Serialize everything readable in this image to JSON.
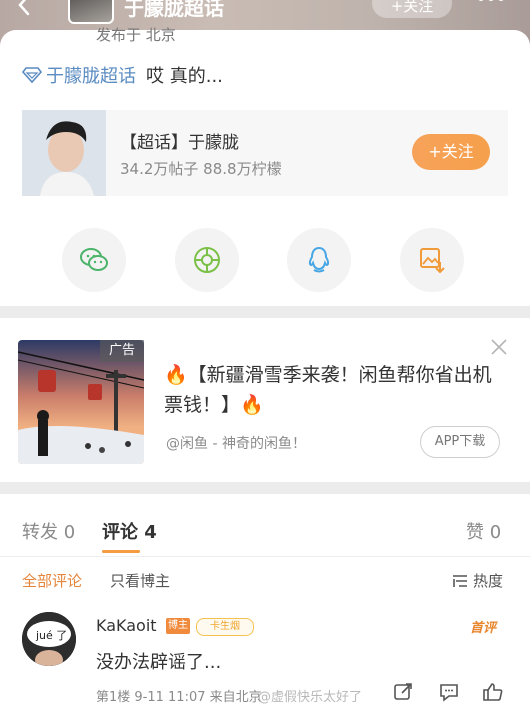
{
  "header": {
    "title": "于朦胧超话",
    "follow_label": "+关注"
  },
  "post": {
    "published_from": "发布于 北京",
    "topic_link": "于朦胧超话",
    "text": "哎 真的...",
    "topic_card": {
      "name": "【超话】于朦胧",
      "stats": "34.2万帖子 88.8万柠檬",
      "follow_label": "+关注"
    },
    "share_icons": [
      "wechat-icon",
      "moments-icon",
      "qq-icon",
      "save-image-icon"
    ]
  },
  "ad": {
    "badge": "广告",
    "title": "🔥【新疆滑雪季来袭！闲鱼帮你省出机票钱！】🔥",
    "source": "@闲鱼 - 神奇的闲鱼！",
    "download_label": "APP下载"
  },
  "comments": {
    "tabs": {
      "repost": "转发 0",
      "comment": "评论 4",
      "like": "赞 0"
    },
    "filters": {
      "all": "全部评论",
      "owner_only": "只看博主",
      "sort": "热度"
    },
    "items": [
      {
        "user": "KaKaoit",
        "avatar_text": "jué 了",
        "badge_blogger": "博主",
        "badge_fan": "卡生烟",
        "first_label": "首评",
        "text": "没办法辟谣了...",
        "meta": "第1楼 9-11 11:07 来自北京",
        "watermark": "@虚假快乐太好了"
      }
    ]
  },
  "colors": {
    "accent_orange": "#f49c3f",
    "link_blue": "#5a8bc1"
  }
}
